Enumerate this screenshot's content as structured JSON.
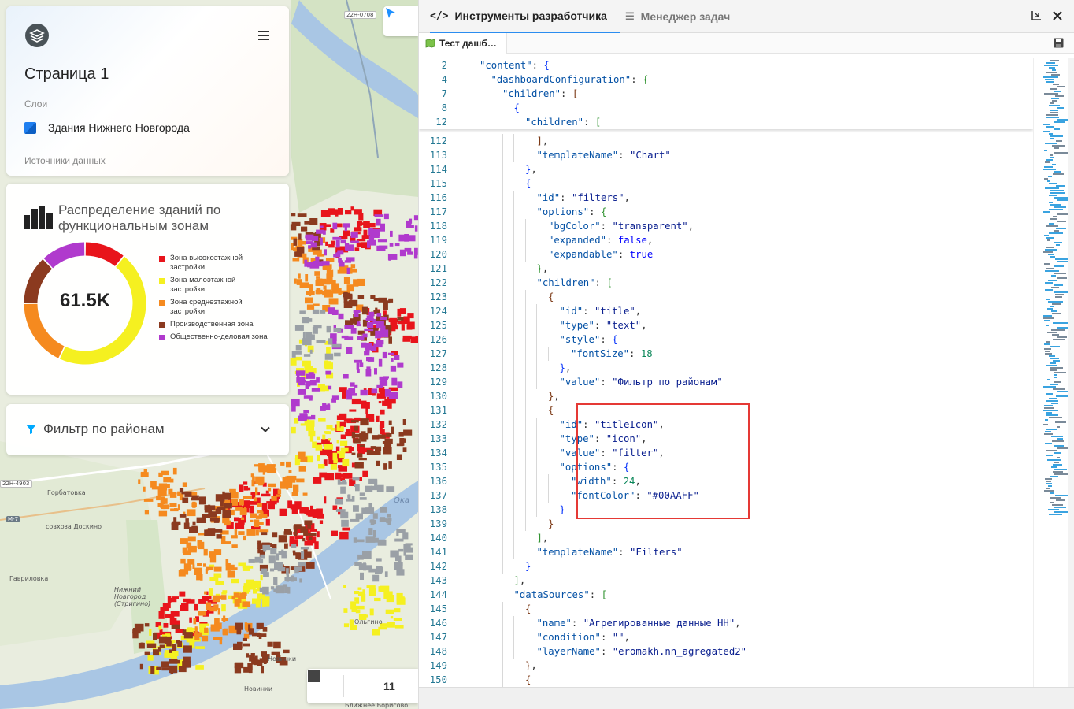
{
  "map": {
    "labels": [
      {
        "text": "Горбатовка"
      },
      {
        "text": "совхоза Доскино"
      },
      {
        "text": "Гавриловка"
      },
      {
        "text": "Нижний Новгород (Стригино)"
      },
      {
        "text": "Ольгино"
      },
      {
        "text": "Новинки"
      },
      {
        "text": "Новинки"
      },
      {
        "text": "Ближнее Борисово"
      }
    ],
    "road_badges": [
      "22Н-0708",
      "22Н-4903",
      "М-7"
    ],
    "river_label": "Ока"
  },
  "page_card": {
    "title": "Страница 1",
    "layers_label": "Слои",
    "layer_name": "Здания Нижнего Новгорода",
    "sources_label": "Источники данных"
  },
  "chart_card": {
    "title": "Распределение зданий по функциональным зонам",
    "center_value": "61.5K",
    "legend": [
      {
        "label": "Зона высокоэтажной застройки",
        "color": "#e8141b"
      },
      {
        "label": "Зона малоэтажной застройки",
        "color": "#f5f020"
      },
      {
        "label": "Зона среднеэтажной застройки",
        "color": "#f58a1f"
      },
      {
        "label": "Производственная зона",
        "color": "#8b3a1f"
      },
      {
        "label": "Общественно-деловая зона",
        "color": "#b03acd"
      }
    ]
  },
  "chart_data": {
    "type": "pie",
    "title": "Распределение зданий по функциональным зонам",
    "total_label": "61.5K",
    "categories": [
      "Зона высокоэтажной застройки",
      "Зона малоэтажной застройки",
      "Зона среднеэтажной застройки",
      "Производственная зона",
      "Общественно-деловая зона"
    ],
    "values": [
      11,
      46,
      18,
      13,
      12
    ],
    "unit": "percent (estimated)",
    "colors": [
      "#e8141b",
      "#f5f020",
      "#f58a1f",
      "#8b3a1f",
      "#b03acd"
    ],
    "legend_position": "right"
  },
  "filter_card": {
    "title": "Фильтр по районам"
  },
  "map_toolbar": {
    "count": "11"
  },
  "devpanel": {
    "tab_devtools": "Инструменты разработчика",
    "tab_tasks": "Менеджер задач",
    "file_tab": "Тест дашб…",
    "sticky_lines": [
      {
        "num": "2",
        "indent": 3,
        "tokens": [
          [
            "k",
            "\"content\""
          ],
          [
            "p",
            ": "
          ],
          [
            "b1",
            "{"
          ]
        ]
      },
      {
        "num": "4",
        "indent": 4,
        "tokens": [
          [
            "k",
            "\"dashboardConfiguration\""
          ],
          [
            "p",
            ": "
          ],
          [
            "b2",
            "{"
          ]
        ]
      },
      {
        "num": "7",
        "indent": 5,
        "tokens": [
          [
            "k",
            "\"children\""
          ],
          [
            "p",
            ": "
          ],
          [
            "b3",
            "["
          ]
        ]
      },
      {
        "num": "8",
        "indent": 6,
        "tokens": [
          [
            "b1",
            "{"
          ]
        ]
      },
      {
        "num": "12",
        "indent": 7,
        "tokens": [
          [
            "k",
            "\"children\""
          ],
          [
            "p",
            ": "
          ],
          [
            "b2",
            "["
          ]
        ]
      }
    ],
    "lines": [
      {
        "num": "112",
        "indent": 8,
        "tokens": [
          [
            "b3",
            "]"
          ],
          [
            "p",
            ","
          ]
        ]
      },
      {
        "num": "113",
        "indent": 8,
        "tokens": [
          [
            "k",
            "\"templateName\""
          ],
          [
            "p",
            ": "
          ],
          [
            "s",
            "\"Chart\""
          ]
        ]
      },
      {
        "num": "114",
        "indent": 7,
        "tokens": [
          [
            "b1",
            "}"
          ],
          [
            "p",
            ","
          ]
        ]
      },
      {
        "num": "115",
        "indent": 7,
        "tokens": [
          [
            "b1",
            "{"
          ]
        ]
      },
      {
        "num": "116",
        "indent": 8,
        "tokens": [
          [
            "k",
            "\"id\""
          ],
          [
            "p",
            ": "
          ],
          [
            "s",
            "\"filters\""
          ],
          [
            "p",
            ","
          ]
        ]
      },
      {
        "num": "117",
        "indent": 8,
        "tokens": [
          [
            "k",
            "\"options\""
          ],
          [
            "p",
            ": "
          ],
          [
            "b2",
            "{"
          ]
        ]
      },
      {
        "num": "118",
        "indent": 9,
        "tokens": [
          [
            "k",
            "\"bgColor\""
          ],
          [
            "p",
            ": "
          ],
          [
            "s",
            "\"transparent\""
          ],
          [
            "p",
            ","
          ]
        ]
      },
      {
        "num": "119",
        "indent": 9,
        "tokens": [
          [
            "k",
            "\"expanded\""
          ],
          [
            "p",
            ": "
          ],
          [
            "kw",
            "false"
          ],
          [
            "p",
            ","
          ]
        ]
      },
      {
        "num": "120",
        "indent": 9,
        "tokens": [
          [
            "k",
            "\"expandable\""
          ],
          [
            "p",
            ": "
          ],
          [
            "kw",
            "true"
          ]
        ]
      },
      {
        "num": "121",
        "indent": 8,
        "tokens": [
          [
            "b2",
            "}"
          ],
          [
            "p",
            ","
          ]
        ]
      },
      {
        "num": "122",
        "indent": 8,
        "tokens": [
          [
            "k",
            "\"children\""
          ],
          [
            "p",
            ": "
          ],
          [
            "b2",
            "["
          ]
        ]
      },
      {
        "num": "123",
        "indent": 9,
        "tokens": [
          [
            "b3",
            "{"
          ]
        ]
      },
      {
        "num": "124",
        "indent": 10,
        "tokens": [
          [
            "k",
            "\"id\""
          ],
          [
            "p",
            ": "
          ],
          [
            "s",
            "\"title\""
          ],
          [
            "p",
            ","
          ]
        ]
      },
      {
        "num": "125",
        "indent": 10,
        "tokens": [
          [
            "k",
            "\"type\""
          ],
          [
            "p",
            ": "
          ],
          [
            "s",
            "\"text\""
          ],
          [
            "p",
            ","
          ]
        ]
      },
      {
        "num": "126",
        "indent": 10,
        "tokens": [
          [
            "k",
            "\"style\""
          ],
          [
            "p",
            ": "
          ],
          [
            "b1",
            "{"
          ]
        ]
      },
      {
        "num": "127",
        "indent": 11,
        "tokens": [
          [
            "k",
            "\"fontSize\""
          ],
          [
            "p",
            ": "
          ],
          [
            "n",
            "18"
          ]
        ]
      },
      {
        "num": "128",
        "indent": 10,
        "tokens": [
          [
            "b1",
            "}"
          ],
          [
            "p",
            ","
          ]
        ]
      },
      {
        "num": "129",
        "indent": 10,
        "tokens": [
          [
            "k",
            "\"value\""
          ],
          [
            "p",
            ": "
          ],
          [
            "s",
            "\"Фильтр по районам\""
          ]
        ]
      },
      {
        "num": "130",
        "indent": 9,
        "tokens": [
          [
            "b3",
            "}"
          ],
          [
            "p",
            ","
          ]
        ]
      },
      {
        "num": "131",
        "indent": 9,
        "tokens": [
          [
            "b3",
            "{"
          ]
        ]
      },
      {
        "num": "132",
        "indent": 10,
        "tokens": [
          [
            "k",
            "\"id\""
          ],
          [
            "p",
            ": "
          ],
          [
            "s",
            "\"titleIcon\""
          ],
          [
            "p",
            ","
          ]
        ]
      },
      {
        "num": "133",
        "indent": 10,
        "tokens": [
          [
            "k",
            "\"type\""
          ],
          [
            "p",
            ": "
          ],
          [
            "s",
            "\"icon\""
          ],
          [
            "p",
            ","
          ]
        ]
      },
      {
        "num": "134",
        "indent": 10,
        "tokens": [
          [
            "k",
            "\"value\""
          ],
          [
            "p",
            ": "
          ],
          [
            "s",
            "\"filter\""
          ],
          [
            "p",
            ","
          ]
        ]
      },
      {
        "num": "135",
        "indent": 10,
        "tokens": [
          [
            "k",
            "\"options\""
          ],
          [
            "p",
            ": "
          ],
          [
            "b1",
            "{"
          ]
        ]
      },
      {
        "num": "136",
        "indent": 11,
        "tokens": [
          [
            "k",
            "\"width\""
          ],
          [
            "p",
            ": "
          ],
          [
            "n",
            "24"
          ],
          [
            "p",
            ","
          ]
        ]
      },
      {
        "num": "137",
        "indent": 11,
        "tokens": [
          [
            "k",
            "\"fontColor\""
          ],
          [
            "p",
            ": "
          ],
          [
            "s",
            "\"#00AAFF\""
          ]
        ]
      },
      {
        "num": "138",
        "indent": 10,
        "tokens": [
          [
            "b1",
            "}"
          ]
        ]
      },
      {
        "num": "139",
        "indent": 9,
        "tokens": [
          [
            "b3",
            "}"
          ]
        ]
      },
      {
        "num": "140",
        "indent": 8,
        "tokens": [
          [
            "b2",
            "]"
          ],
          [
            "p",
            ","
          ]
        ]
      },
      {
        "num": "141",
        "indent": 8,
        "tokens": [
          [
            "k",
            "\"templateName\""
          ],
          [
            "p",
            ": "
          ],
          [
            "s",
            "\"Filters\""
          ]
        ]
      },
      {
        "num": "142",
        "indent": 7,
        "tokens": [
          [
            "b1",
            "}"
          ]
        ]
      },
      {
        "num": "143",
        "indent": 6,
        "tokens": [
          [
            "b2",
            "]"
          ],
          [
            "p",
            ","
          ]
        ]
      },
      {
        "num": "144",
        "indent": 6,
        "tokens": [
          [
            "k",
            "\"dataSources\""
          ],
          [
            "p",
            ": "
          ],
          [
            "b2",
            "["
          ]
        ]
      },
      {
        "num": "145",
        "indent": 7,
        "tokens": [
          [
            "b3",
            "{"
          ]
        ]
      },
      {
        "num": "146",
        "indent": 8,
        "tokens": [
          [
            "k",
            "\"name\""
          ],
          [
            "p",
            ": "
          ],
          [
            "s",
            "\"Агрегированные данные НН\""
          ],
          [
            "p",
            ","
          ]
        ]
      },
      {
        "num": "147",
        "indent": 8,
        "tokens": [
          [
            "k",
            "\"condition\""
          ],
          [
            "p",
            ": "
          ],
          [
            "s",
            "\"\""
          ],
          [
            "p",
            ","
          ]
        ]
      },
      {
        "num": "148",
        "indent": 8,
        "tokens": [
          [
            "k",
            "\"layerName\""
          ],
          [
            "p",
            ": "
          ],
          [
            "s",
            "\"eromakh.nn_agregated2\""
          ]
        ]
      },
      {
        "num": "149",
        "indent": 7,
        "tokens": [
          [
            "b3",
            "}"
          ],
          [
            "p",
            ","
          ]
        ]
      },
      {
        "num": "150",
        "indent": 7,
        "tokens": [
          [
            "b3",
            "{"
          ]
        ]
      }
    ]
  }
}
